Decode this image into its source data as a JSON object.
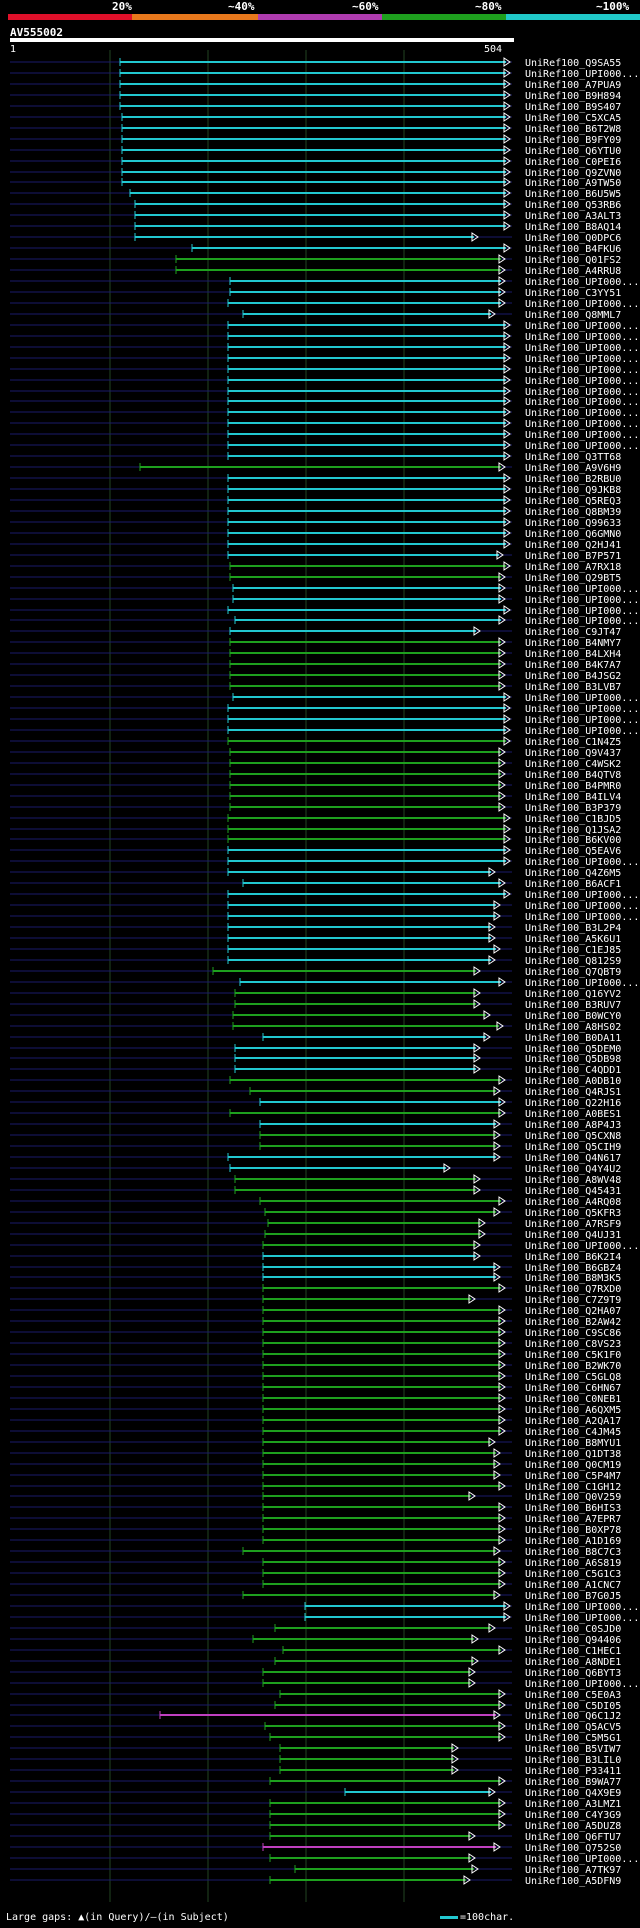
{
  "legend": {
    "labels": [
      "20%",
      "~40%",
      "~60%",
      "~80%",
      "~100%"
    ],
    "colors": [
      "#e0102a",
      "#e8781c",
      "#b03cb0",
      "#1ea01e",
      "#20c8c8"
    ]
  },
  "query": {
    "name": "AV555002",
    "start": "1",
    "end": "504"
  },
  "footer": {
    "gaps": "Large gaps: ▲(in Query)/–(in Subject)",
    "scale": "=100char."
  },
  "hits": [
    {
      "name": "UniRef100_Q9SA55",
      "start": 120,
      "end": 510,
      "color": "c"
    },
    {
      "name": "UniRef100_UPI000...",
      "start": 120,
      "end": 510,
      "color": "c"
    },
    {
      "name": "UniRef100_A7PUA9",
      "start": 120,
      "end": 510,
      "color": "c"
    },
    {
      "name": "UniRef100_B9H894",
      "start": 120,
      "end": 510,
      "color": "c"
    },
    {
      "name": "UniRef100_B9S407",
      "start": 120,
      "end": 510,
      "color": "c"
    },
    {
      "name": "UniRef100_C5XCA5",
      "start": 122,
      "end": 510,
      "color": "c"
    },
    {
      "name": "UniRef100_B6T2W8",
      "start": 122,
      "end": 510,
      "color": "c"
    },
    {
      "name": "UniRef100_B9FY09",
      "start": 122,
      "end": 510,
      "color": "c"
    },
    {
      "name": "UniRef100_Q6YTU0",
      "start": 122,
      "end": 510,
      "color": "c"
    },
    {
      "name": "UniRef100_C0PEI6",
      "start": 122,
      "end": 510,
      "color": "c"
    },
    {
      "name": "UniRef100_Q9ZVN0",
      "start": 122,
      "end": 510,
      "color": "c"
    },
    {
      "name": "UniRef100_A9TW50",
      "start": 122,
      "end": 510,
      "color": "c"
    },
    {
      "name": "UniRef100_B6U5W5",
      "start": 130,
      "end": 510,
      "color": "c"
    },
    {
      "name": "UniRef100_Q53RB6",
      "start": 135,
      "end": 510,
      "color": "c"
    },
    {
      "name": "UniRef100_A3ALT3",
      "start": 135,
      "end": 510,
      "color": "c"
    },
    {
      "name": "UniRef100_B8AQ14",
      "start": 135,
      "end": 510,
      "color": "c"
    },
    {
      "name": "UniRef100_Q0DPC6",
      "start": 135,
      "end": 478,
      "color": "c"
    },
    {
      "name": "UniRef100_B4FKU6",
      "start": 192,
      "end": 510,
      "color": "c"
    },
    {
      "name": "UniRef100_Q01FS2",
      "start": 176,
      "end": 505,
      "color": "g"
    },
    {
      "name": "UniRef100_A4RRU8",
      "start": 176,
      "end": 505,
      "color": "g"
    },
    {
      "name": "UniRef100_UPI000...",
      "start": 230,
      "end": 505,
      "color": "c"
    },
    {
      "name": "UniRef100_C3YY51",
      "start": 230,
      "end": 505,
      "color": "c"
    },
    {
      "name": "UniRef100_UPI000...",
      "start": 228,
      "end": 505,
      "color": "c"
    },
    {
      "name": "UniRef100_Q8MML7",
      "start": 243,
      "end": 495,
      "color": "c"
    },
    {
      "name": "UniRef100_UPI000...",
      "start": 228,
      "end": 510,
      "color": "c"
    },
    {
      "name": "UniRef100_UPI000...",
      "start": 228,
      "end": 510,
      "color": "c"
    },
    {
      "name": "UniRef100_UPI000...",
      "start": 228,
      "end": 510,
      "color": "c"
    },
    {
      "name": "UniRef100_UPI000...",
      "start": 228,
      "end": 510,
      "color": "c"
    },
    {
      "name": "UniRef100_UPI000...",
      "start": 228,
      "end": 510,
      "color": "c"
    },
    {
      "name": "UniRef100_UPI000...",
      "start": 228,
      "end": 510,
      "color": "c"
    },
    {
      "name": "UniRef100_UPI000...",
      "start": 228,
      "end": 510,
      "color": "c"
    },
    {
      "name": "UniRef100_UPI000...",
      "start": 228,
      "end": 510,
      "color": "c"
    },
    {
      "name": "UniRef100_UPI000...",
      "start": 228,
      "end": 510,
      "color": "c"
    },
    {
      "name": "UniRef100_UPI000...",
      "start": 228,
      "end": 510,
      "color": "c"
    },
    {
      "name": "UniRef100_UPI000...",
      "start": 228,
      "end": 510,
      "color": "c"
    },
    {
      "name": "UniRef100_UPI000...",
      "start": 228,
      "end": 510,
      "color": "c"
    },
    {
      "name": "UniRef100_Q3TT68",
      "start": 228,
      "end": 510,
      "color": "c"
    },
    {
      "name": "UniRef100_A9V6H9",
      "start": 140,
      "end": 505,
      "color": "g"
    },
    {
      "name": "UniRef100_B2RBU0",
      "start": 228,
      "end": 510,
      "color": "c"
    },
    {
      "name": "UniRef100_Q9JKB8",
      "start": 228,
      "end": 510,
      "color": "c"
    },
    {
      "name": "UniRef100_Q5REQ3",
      "start": 228,
      "end": 510,
      "color": "c"
    },
    {
      "name": "UniRef100_Q8BM39",
      "start": 228,
      "end": 510,
      "color": "c"
    },
    {
      "name": "UniRef100_Q99633",
      "start": 228,
      "end": 510,
      "color": "c"
    },
    {
      "name": "UniRef100_Q6GMN0",
      "start": 228,
      "end": 510,
      "color": "c"
    },
    {
      "name": "UniRef100_Q2HJ41",
      "start": 228,
      "end": 510,
      "color": "c"
    },
    {
      "name": "UniRef100_B7P571",
      "start": 228,
      "end": 503,
      "color": "c"
    },
    {
      "name": "UniRef100_A7RX18",
      "start": 230,
      "end": 510,
      "color": "g"
    },
    {
      "name": "UniRef100_Q29BT5",
      "start": 230,
      "end": 505,
      "color": "g"
    },
    {
      "name": "UniRef100_UPI000...",
      "start": 233,
      "end": 505,
      "color": "c"
    },
    {
      "name": "UniRef100_UPI000...",
      "start": 233,
      "end": 505,
      "color": "c"
    },
    {
      "name": "UniRef100_UPI000...",
      "start": 228,
      "end": 510,
      "color": "c"
    },
    {
      "name": "UniRef100_UPI000...",
      "start": 235,
      "end": 505,
      "color": "c"
    },
    {
      "name": "UniRef100_C9JT47",
      "start": 230,
      "end": 480,
      "color": "c"
    },
    {
      "name": "UniRef100_B4NMY7",
      "start": 230,
      "end": 505,
      "color": "g"
    },
    {
      "name": "UniRef100_B4LXH4",
      "start": 230,
      "end": 505,
      "color": "g"
    },
    {
      "name": "UniRef100_B4K7A7",
      "start": 230,
      "end": 505,
      "color": "g"
    },
    {
      "name": "UniRef100_B4JSG2",
      "start": 230,
      "end": 505,
      "color": "g"
    },
    {
      "name": "UniRef100_B3LVB7",
      "start": 230,
      "end": 505,
      "color": "g"
    },
    {
      "name": "UniRef100_UPI000...",
      "start": 233,
      "end": 510,
      "color": "c"
    },
    {
      "name": "UniRef100_UPI000...",
      "start": 228,
      "end": 510,
      "color": "c"
    },
    {
      "name": "UniRef100_UPI000...",
      "start": 228,
      "end": 510,
      "color": "c"
    },
    {
      "name": "UniRef100_UPI000...",
      "start": 228,
      "end": 510,
      "color": "c"
    },
    {
      "name": "UniRef100_C1N4Z5",
      "start": 228,
      "end": 510,
      "color": "g"
    },
    {
      "name": "UniRef100_Q9V437",
      "start": 230,
      "end": 505,
      "color": "g"
    },
    {
      "name": "UniRef100_C4WSK2",
      "start": 230,
      "end": 505,
      "color": "g"
    },
    {
      "name": "UniRef100_B4QTV8",
      "start": 230,
      "end": 505,
      "color": "g"
    },
    {
      "name": "UniRef100_B4PMR0",
      "start": 230,
      "end": 505,
      "color": "g"
    },
    {
      "name": "UniRef100_B4ILV4",
      "start": 230,
      "end": 505,
      "color": "g"
    },
    {
      "name": "UniRef100_B3P379",
      "start": 230,
      "end": 505,
      "color": "g"
    },
    {
      "name": "UniRef100_C1BJD5",
      "start": 228,
      "end": 510,
      "color": "g"
    },
    {
      "name": "UniRef100_Q1JSA2",
      "start": 228,
      "end": 510,
      "color": "g"
    },
    {
      "name": "UniRef100_B6KV00",
      "start": 228,
      "end": 510,
      "color": "g"
    },
    {
      "name": "UniRef100_Q5EAV6",
      "start": 228,
      "end": 510,
      "color": "c"
    },
    {
      "name": "UniRef100_UPI000...",
      "start": 228,
      "end": 510,
      "color": "c"
    },
    {
      "name": "UniRef100_Q4Z6M5",
      "start": 228,
      "end": 495,
      "color": "c"
    },
    {
      "name": "UniRef100_B6ACF1",
      "start": 243,
      "end": 505,
      "color": "c"
    },
    {
      "name": "UniRef100_UPI000...",
      "start": 228,
      "end": 510,
      "color": "c"
    },
    {
      "name": "UniRef100_UPI000...",
      "start": 228,
      "end": 500,
      "color": "c"
    },
    {
      "name": "UniRef100_UPI000...",
      "start": 228,
      "end": 500,
      "color": "c"
    },
    {
      "name": "UniRef100_B3L2P4",
      "start": 228,
      "end": 495,
      "color": "c"
    },
    {
      "name": "UniRef100_A5K6U1",
      "start": 228,
      "end": 495,
      "color": "c"
    },
    {
      "name": "UniRef100_C1EJ85",
      "start": 228,
      "end": 500,
      "color": "c"
    },
    {
      "name": "UniRef100_Q812S9",
      "start": 228,
      "end": 495,
      "color": "c"
    },
    {
      "name": "UniRef100_Q7QBT9",
      "start": 213,
      "end": 480,
      "color": "g"
    },
    {
      "name": "UniRef100_UPI000...",
      "start": 240,
      "end": 505,
      "color": "c"
    },
    {
      "name": "UniRef100_Q16YV2",
      "start": 235,
      "end": 480,
      "color": "g"
    },
    {
      "name": "UniRef100_B3RUV7",
      "start": 235,
      "end": 480,
      "color": "g"
    },
    {
      "name": "UniRef100_B0WCY0",
      "start": 233,
      "end": 490,
      "color": "g"
    },
    {
      "name": "UniRef100_A8HS02",
      "start": 233,
      "end": 503,
      "color": "g"
    },
    {
      "name": "UniRef100_B0DA11",
      "start": 263,
      "end": 490,
      "color": "c"
    },
    {
      "name": "UniRef100_Q5DEM0",
      "start": 235,
      "end": 480,
      "color": "c"
    },
    {
      "name": "UniRef100_Q5DB98",
      "start": 235,
      "end": 480,
      "color": "c"
    },
    {
      "name": "UniRef100_C4QDD1",
      "start": 235,
      "end": 480,
      "color": "c"
    },
    {
      "name": "UniRef100_A0DB10",
      "start": 230,
      "end": 505,
      "color": "g"
    },
    {
      "name": "UniRef100_Q4RJS1",
      "start": 250,
      "end": 500,
      "color": "g"
    },
    {
      "name": "UniRef100_Q22H16",
      "start": 260,
      "end": 505,
      "color": "c"
    },
    {
      "name": "UniRef100_A0BES1",
      "start": 230,
      "end": 505,
      "color": "g"
    },
    {
      "name": "UniRef100_A8P4J3",
      "start": 260,
      "end": 500,
      "color": "c"
    },
    {
      "name": "UniRef100_Q5CXN8",
      "start": 260,
      "end": 500,
      "color": "g"
    },
    {
      "name": "UniRef100_Q5CIH9",
      "start": 260,
      "end": 500,
      "color": "g"
    },
    {
      "name": "UniRef100_Q4N617",
      "start": 228,
      "end": 500,
      "color": "c"
    },
    {
      "name": "UniRef100_Q4Y4U2",
      "start": 230,
      "end": 450,
      "color": "c"
    },
    {
      "name": "UniRef100_A8WV48",
      "start": 235,
      "end": 480,
      "color": "g"
    },
    {
      "name": "UniRef100_Q45431",
      "start": 235,
      "end": 480,
      "color": "g"
    },
    {
      "name": "UniRef100_A4RQ08",
      "start": 260,
      "end": 505,
      "color": "g"
    },
    {
      "name": "UniRef100_Q5KFR3",
      "start": 265,
      "end": 500,
      "color": "g"
    },
    {
      "name": "UniRef100_A7RSF9",
      "start": 268,
      "end": 485,
      "color": "g"
    },
    {
      "name": "UniRef100_Q4UJ31",
      "start": 265,
      "end": 485,
      "color": "g"
    },
    {
      "name": "UniRef100_UPI000...",
      "start": 263,
      "end": 480,
      "color": "g"
    },
    {
      "name": "UniRef100_B6K2I4",
      "start": 263,
      "end": 480,
      "color": "c"
    },
    {
      "name": "UniRef100_B6GBZ4",
      "start": 263,
      "end": 500,
      "color": "c"
    },
    {
      "name": "UniRef100_B8M3K5",
      "start": 263,
      "end": 500,
      "color": "c"
    },
    {
      "name": "UniRef100_Q7RXD0",
      "start": 263,
      "end": 505,
      "color": "g"
    },
    {
      "name": "UniRef100_C7Z9T9",
      "start": 263,
      "end": 475,
      "color": "g"
    },
    {
      "name": "UniRef100_Q2HA07",
      "start": 263,
      "end": 505,
      "color": "g"
    },
    {
      "name": "UniRef100_B2AW42",
      "start": 263,
      "end": 505,
      "color": "g"
    },
    {
      "name": "UniRef100_C9SC86",
      "start": 263,
      "end": 505,
      "color": "g"
    },
    {
      "name": "UniRef100_C8VS23",
      "start": 263,
      "end": 505,
      "color": "g"
    },
    {
      "name": "UniRef100_C5K1F0",
      "start": 263,
      "end": 505,
      "color": "g"
    },
    {
      "name": "UniRef100_B2WK70",
      "start": 263,
      "end": 505,
      "color": "g"
    },
    {
      "name": "UniRef100_C5GLQ8",
      "start": 263,
      "end": 505,
      "color": "g"
    },
    {
      "name": "UniRef100_C6HN67",
      "start": 263,
      "end": 505,
      "color": "g"
    },
    {
      "name": "UniRef100_C0NEB1",
      "start": 263,
      "end": 505,
      "color": "g"
    },
    {
      "name": "UniRef100_A6QXM5",
      "start": 263,
      "end": 505,
      "color": "g"
    },
    {
      "name": "UniRef100_A2QA17",
      "start": 263,
      "end": 505,
      "color": "g"
    },
    {
      "name": "UniRef100_C4JM45",
      "start": 263,
      "end": 505,
      "color": "g"
    },
    {
      "name": "UniRef100_B8MYU1",
      "start": 263,
      "end": 495,
      "color": "g"
    },
    {
      "name": "UniRef100_Q1DT38",
      "start": 263,
      "end": 500,
      "color": "g"
    },
    {
      "name": "UniRef100_Q0CM19",
      "start": 263,
      "end": 500,
      "color": "g"
    },
    {
      "name": "UniRef100_C5P4M7",
      "start": 263,
      "end": 500,
      "color": "g"
    },
    {
      "name": "UniRef100_C1GH12",
      "start": 263,
      "end": 505,
      "color": "g"
    },
    {
      "name": "UniRef100_Q0V259",
      "start": 263,
      "end": 475,
      "color": "g"
    },
    {
      "name": "UniRef100_B6HIS3",
      "start": 263,
      "end": 505,
      "color": "g"
    },
    {
      "name": "UniRef100_A7EPR7",
      "start": 263,
      "end": 505,
      "color": "g"
    },
    {
      "name": "UniRef100_B0XP78",
      "start": 263,
      "end": 505,
      "color": "g"
    },
    {
      "name": "UniRef100_A1D169",
      "start": 263,
      "end": 505,
      "color": "g"
    },
    {
      "name": "UniRef100_B8C7C3",
      "start": 243,
      "end": 500,
      "color": "g"
    },
    {
      "name": "UniRef100_A6S819",
      "start": 263,
      "end": 505,
      "color": "g"
    },
    {
      "name": "UniRef100_C5G1C3",
      "start": 263,
      "end": 505,
      "color": "g"
    },
    {
      "name": "UniRef100_A1CNC7",
      "start": 263,
      "end": 505,
      "color": "g"
    },
    {
      "name": "UniRef100_B7G0J5",
      "start": 243,
      "end": 500,
      "color": "g"
    },
    {
      "name": "UniRef100_UPI000...",
      "start": 305,
      "end": 510,
      "color": "c"
    },
    {
      "name": "UniRef100_UPI000...",
      "start": 305,
      "end": 510,
      "color": "c"
    },
    {
      "name": "UniRef100_C0SJD0",
      "start": 275,
      "end": 495,
      "color": "g"
    },
    {
      "name": "UniRef100_Q94406",
      "start": 253,
      "end": 478,
      "color": "g"
    },
    {
      "name": "UniRef100_C1HEC1",
      "start": 283,
      "end": 505,
      "color": "g"
    },
    {
      "name": "UniRef100_A8NDE1",
      "start": 275,
      "end": 478,
      "color": "g"
    },
    {
      "name": "UniRef100_Q6BYT3",
      "start": 263,
      "end": 475,
      "color": "g"
    },
    {
      "name": "UniRef100_UPI000...",
      "start": 263,
      "end": 475,
      "color": "g"
    },
    {
      "name": "UniRef100_C5E0A3",
      "start": 280,
      "end": 505,
      "color": "g"
    },
    {
      "name": "UniRef100_C5DI05",
      "start": 275,
      "end": 505,
      "color": "g"
    },
    {
      "name": "UniRef100_Q6C1J2",
      "start": 160,
      "end": 500,
      "color": "m"
    },
    {
      "name": "UniRef100_Q5ACV5",
      "start": 265,
      "end": 505,
      "color": "g"
    },
    {
      "name": "UniRef100_C5M5G1",
      "start": 270,
      "end": 505,
      "color": "g"
    },
    {
      "name": "UniRef100_B5VIW7",
      "start": 280,
      "end": 458,
      "color": "g"
    },
    {
      "name": "UniRef100_B3LIL0",
      "start": 280,
      "end": 458,
      "color": "g"
    },
    {
      "name": "UniRef100_P33411",
      "start": 280,
      "end": 458,
      "color": "g"
    },
    {
      "name": "UniRef100_B9WA77",
      "start": 270,
      "end": 505,
      "color": "g"
    },
    {
      "name": "UniRef100_Q4X9E9",
      "start": 345,
      "end": 495,
      "color": "c"
    },
    {
      "name": "UniRef100_A3LMZ1",
      "start": 270,
      "end": 505,
      "color": "g"
    },
    {
      "name": "UniRef100_C4Y3G9",
      "start": 270,
      "end": 505,
      "color": "g"
    },
    {
      "name": "UniRef100_A5DUZ8",
      "start": 270,
      "end": 505,
      "color": "g"
    },
    {
      "name": "UniRef100_Q6FTU7",
      "start": 270,
      "end": 475,
      "color": "g"
    },
    {
      "name": "UniRef100_Q752S0",
      "start": 263,
      "end": 500,
      "color": "m"
    },
    {
      "name": "UniRef100_UPI000...",
      "start": 270,
      "end": 475,
      "color": "g"
    },
    {
      "name": "UniRef100_A7TK97",
      "start": 295,
      "end": 478,
      "color": "g"
    },
    {
      "name": "UniRef100_A5DFN9",
      "start": 270,
      "end": 470,
      "color": "g"
    }
  ]
}
